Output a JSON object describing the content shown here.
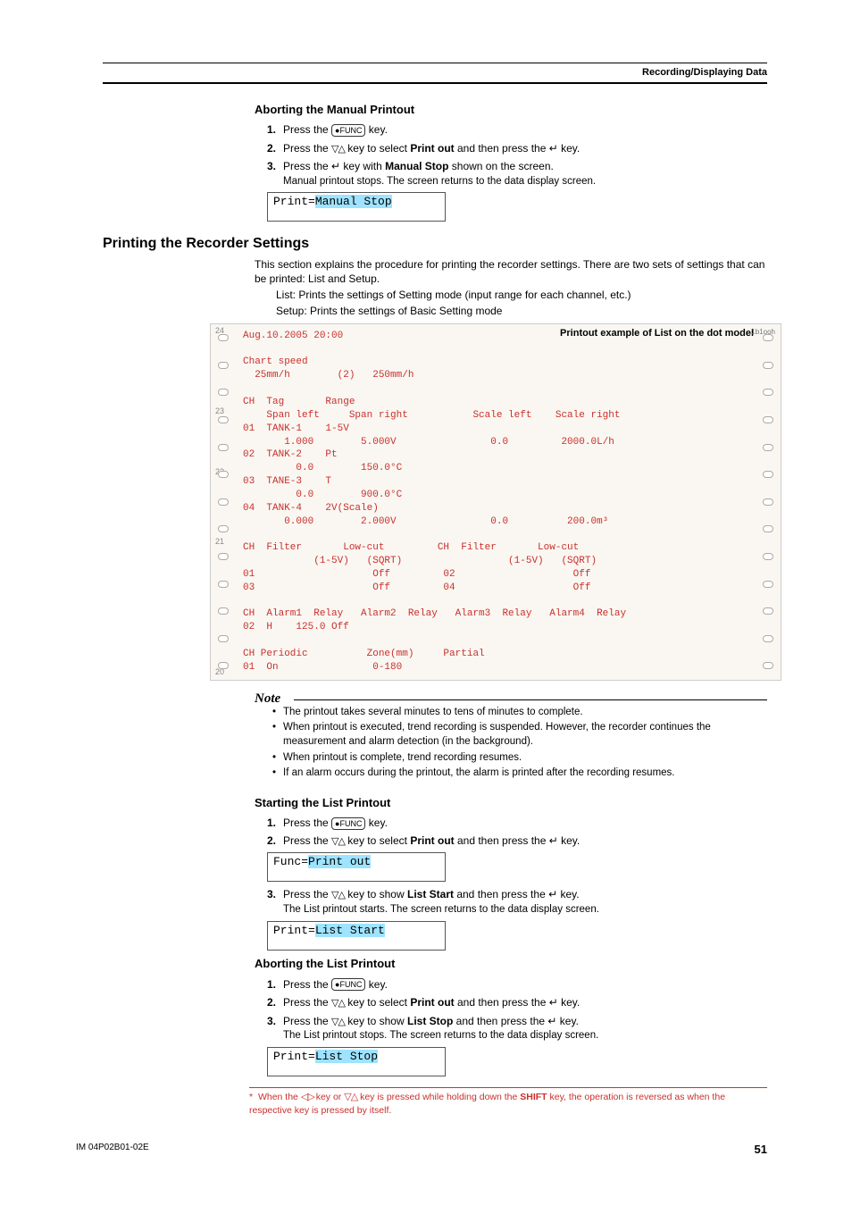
{
  "header": {
    "section": "Recording/Displaying Data"
  },
  "abortManual": {
    "heading": "Aborting the Manual Printout",
    "s1a": "Press the ",
    "s1b": " key.",
    "s2a": "Press the ",
    "s2b": " key to select ",
    "s2bold": "Print out",
    "s2c": " and then press the ",
    "s2d": " key.",
    "s3a": "Press the ",
    "s3b": " key with ",
    "s3bold": "Manual Stop",
    "s3c": " shown on the screen.",
    "s3sub": "Manual printout stops. The screen returns to the data display screen.",
    "screenPrefix": "Print=",
    "screenVal": "Manual Stop"
  },
  "printSettings": {
    "heading": "Printing the Recorder Settings",
    "p1": "This section explains the procedure for printing the recorder settings. There are two sets of settings that can be printed: List and Setup.",
    "p2": "List: Prints the settings of Setting mode (input range for each channel, etc.)",
    "p3": "Setup: Prints the settings of Basic Setting mode"
  },
  "printoutCaption": "Printout example of List on the dot model",
  "chart_data": {
    "type": "table",
    "timestamp": "Aug.10.2005 20:00",
    "chart_speed": {
      "current": "25mm/h",
      "secondary_index": "(2)",
      "secondary": "250mm/h"
    },
    "channels": [
      {
        "ch": "01",
        "tag": "TANK-1",
        "range": "1-5V",
        "span_left": "1.000",
        "span_right": "5.000V",
        "scale_left": "0.0",
        "scale_right": "2000.0L/h"
      },
      {
        "ch": "02",
        "tag": "TANK-2",
        "range": "Pt",
        "span_left": "0.0",
        "span_right": "150.0°C",
        "scale_left": "",
        "scale_right": ""
      },
      {
        "ch": "03",
        "tag": "TANE-3",
        "range": "T",
        "span_left": "0.0",
        "span_right": "900.0°C",
        "scale_left": "",
        "scale_right": ""
      },
      {
        "ch": "04",
        "tag": "TANK-4",
        "range": "2V(Scale)",
        "span_left": "0.000",
        "span_right": "2.000V",
        "scale_left": "0.0",
        "scale_right": "200.0m³"
      }
    ],
    "filter": [
      {
        "ch": "01",
        "filter": "",
        "lowcut_range": "(1-5V)",
        "lowcut_mode": "(SQRT)",
        "value": "Off"
      },
      {
        "ch": "02",
        "filter": "",
        "lowcut_range": "(1-5V)",
        "lowcut_mode": "(SQRT)",
        "value": "Off"
      },
      {
        "ch": "03",
        "filter": "",
        "lowcut_range": "",
        "lowcut_mode": "",
        "value": "Off"
      },
      {
        "ch": "04",
        "filter": "",
        "lowcut_range": "",
        "lowcut_mode": "",
        "value": "Off"
      }
    ],
    "alarm": {
      "ch": "02",
      "alarm1": "H",
      "value": "125.0",
      "relay1": "Off",
      "alarm2": "",
      "relay2": "",
      "alarm3": "",
      "relay3": "",
      "alarm4": "",
      "relay4": ""
    },
    "periodic": {
      "ch": "01",
      "state": "On",
      "zone_mm": "0-180",
      "partial": ""
    }
  },
  "printoutText": "Aug.10.2005 20:00\n\nChart speed\n  25mm/h        (2)   250mm/h\n\nCH  Tag       Range\n    Span left     Span right           Scale left    Scale right\n01  TANK-1    1-5V\n       1.000        5.000V                0.0         2000.0L/h\n02  TANK-2    Pt\n         0.0        150.0°C\n03  TANE-3    T\n         0.0        900.0°C\n04  TANK-4    2V(Scale)\n       0.000        2.000V                0.0          200.0m³\n\nCH  Filter       Low-cut         CH  Filter       Low-cut\n            (1-5V)   (SQRT)                  (1-5V)   (SQRT)\n01                    Off         02                    Off\n03                    Off         04                    Off\n\nCH  Alarm1  Relay   Alarm2  Relay   Alarm3  Relay   Alarm4  Relay\n02  H    125.0 Off\n\nCH Periodic          Zone(mm)     Partial\n01  On                0-180",
  "note": {
    "heading": "Note",
    "items": [
      "The printout takes several minutes to tens of minutes to complete.",
      "When printout is executed, trend recording is suspended. However, the recorder continues the measurement and alarm detection (in the background).",
      "When printout is complete, trend recording resumes.",
      "If an alarm occurs during the printout, the alarm is printed after the recording resumes."
    ]
  },
  "startList": {
    "heading": "Starting the List Printout",
    "s1a": "Press the ",
    "s1b": " key.",
    "s2a": "Press the ",
    "s2b": " key to select ",
    "s2bold": "Print out",
    "s2c": " and then press the ",
    "s2d": " key.",
    "screenA_prefix": "Func=",
    "screenA_val": "Print out",
    "s3a": "Press the ",
    "s3b": " key to show ",
    "s3bold": "List Start",
    "s3c": " and then press the ",
    "s3d": " key.",
    "s3sub": "The List printout starts. The screen returns to the data display screen.",
    "screenB_prefix": "Print=",
    "screenB_val": "List Start"
  },
  "abortList": {
    "heading": "Aborting the List Printout",
    "s1a": "Press the ",
    "s1b": " key.",
    "s2a": "Press the ",
    "s2b": " key to select ",
    "s2bold": "Print out",
    "s2c": " and then press the ",
    "s2d": " key.",
    "s3a": "Press the ",
    "s3b": " key to show ",
    "s3bold": "List Stop",
    "s3c": " and then press the ",
    "s3d": " key.",
    "s3sub": "The List printout stops. The screen returns to the data display screen.",
    "screenPrefix": "Print=",
    "screenVal": "List Stop"
  },
  "footnote": {
    "a": "When the ",
    "b": " key or ",
    "c": " key is pressed while holding down the ",
    "bold": "SHIFT",
    "d": " key, the operation is reversed as when the respective key is pressed by itself."
  },
  "footer": {
    "doc": "IM 04P02B01-02E",
    "page": "51"
  },
  "glyph": {
    "func": "●FUNC",
    "updown": "▽△",
    "enter": "↵",
    "leftright": "◁ ▷",
    "star": "*"
  }
}
